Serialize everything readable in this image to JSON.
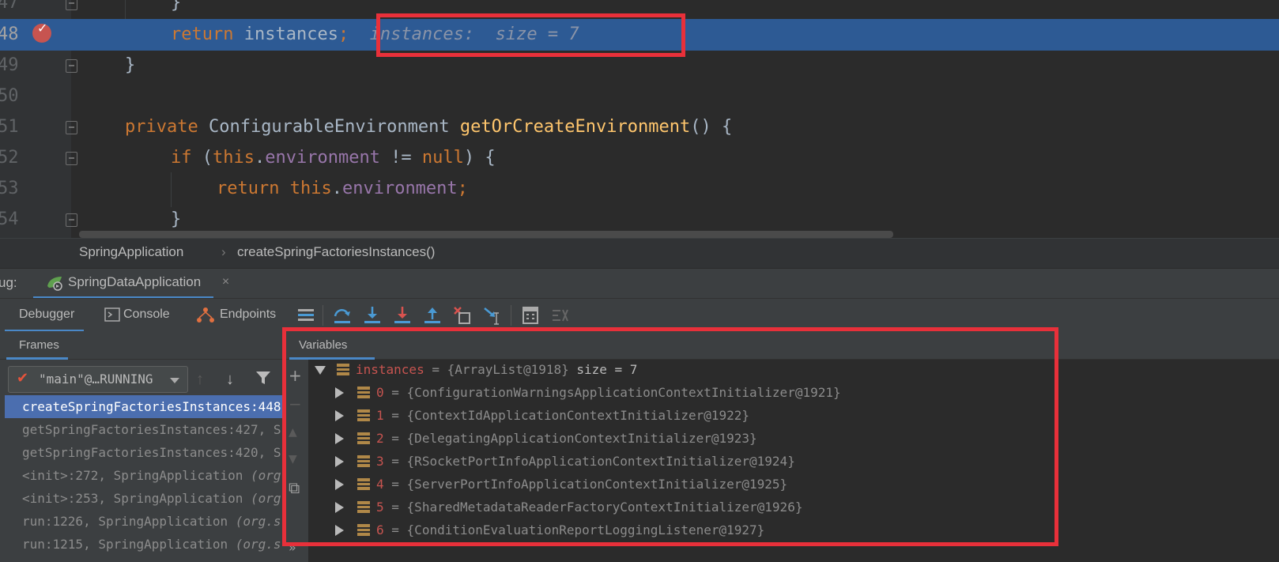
{
  "editor": {
    "lines": [
      {
        "num": "47",
        "code": [
          {
            "t": "}",
            "c": "plain"
          }
        ]
      },
      {
        "num": "48",
        "code": [
          {
            "t": "return",
            "c": "kw"
          },
          {
            "t": " instances",
            "c": "plain"
          },
          {
            "t": ";",
            "c": "kw"
          }
        ],
        "hint": "instances:  size = 7"
      },
      {
        "num": "49",
        "code": [
          {
            "t": "}",
            "c": "plain"
          }
        ]
      },
      {
        "num": "50",
        "code": []
      },
      {
        "num": "51",
        "code": [
          {
            "t": "private",
            "c": "kw"
          },
          {
            "t": " ConfigurableEnvironment ",
            "c": "plain"
          },
          {
            "t": "getOrCreateEnvironment",
            "c": "fn"
          },
          {
            "t": "() {",
            "c": "plain"
          }
        ]
      },
      {
        "num": "52",
        "code": [
          {
            "t": "if",
            "c": "kw"
          },
          {
            "t": " (",
            "c": "plain"
          },
          {
            "t": "this",
            "c": "kw"
          },
          {
            "t": ".",
            "c": "plain"
          },
          {
            "t": "environment",
            "c": "fld"
          },
          {
            "t": " != ",
            "c": "plain"
          },
          {
            "t": "null",
            "c": "kw"
          },
          {
            "t": ") {",
            "c": "plain"
          }
        ]
      },
      {
        "num": "53",
        "code": [
          {
            "t": "return",
            "c": "kw"
          },
          {
            "t": " ",
            "c": "plain"
          },
          {
            "t": "this",
            "c": "kw"
          },
          {
            "t": ".",
            "c": "plain"
          },
          {
            "t": "environment",
            "c": "fld"
          },
          {
            "t": ";",
            "c": "kw"
          }
        ]
      },
      {
        "num": "54",
        "code": [
          {
            "t": "}",
            "c": "plain"
          }
        ]
      }
    ]
  },
  "breadcrumb": {
    "class_name": "SpringApplication",
    "separator": "›",
    "method": "createSpringFactoriesInstances()"
  },
  "debug": {
    "label": "ug:",
    "run_config": "SpringDataApplication",
    "close": "×"
  },
  "toolbar": {
    "tabs": [
      "Debugger",
      "Console",
      "Endpoints"
    ],
    "buttons": [
      "layout-icon",
      "step-over-icon",
      "step-into-icon",
      "force-step-into-icon",
      "step-out-icon",
      "drop-frame-icon",
      "run-to-cursor-icon",
      "evaluate-expression-icon",
      "trace-icon"
    ]
  },
  "frames": {
    "title": "Frames",
    "thread": "\"main\"@…RUNNING",
    "items": [
      {
        "text": "createSpringFactoriesInstances:448",
        "extra": ""
      },
      {
        "text": "getSpringFactoriesInstances:427, S",
        "extra": ""
      },
      {
        "text": "getSpringFactoriesInstances:420, S",
        "extra": ""
      },
      {
        "text": "<init>:272, SpringApplication ",
        "extra": "(org"
      },
      {
        "text": "<init>:253, SpringApplication ",
        "extra": "(org"
      },
      {
        "text": "run:1226, SpringApplication ",
        "extra": "(org.s"
      },
      {
        "text": "run:1215, SpringApplication ",
        "extra": "(org.s"
      }
    ]
  },
  "variables": {
    "title": "Variables",
    "root": {
      "name": "instances",
      "eq": " = ",
      "value": "{ArrayList@1918}",
      "size": "  size = 7"
    },
    "children": [
      {
        "name": "0",
        "value": "{ConfigurationWarningsApplicationContextInitializer@1921}"
      },
      {
        "name": "1",
        "value": "{ContextIdApplicationContextInitializer@1922}"
      },
      {
        "name": "2",
        "value": "{DelegatingApplicationContextInitializer@1923}"
      },
      {
        "name": "3",
        "value": "{RSocketPortInfoApplicationContextInitializer@1924}"
      },
      {
        "name": "4",
        "value": "{ServerPortInfoApplicationContextInitializer@1925}"
      },
      {
        "name": "5",
        "value": "{SharedMetadataReaderFactoryContextInitializer@1926}"
      },
      {
        "name": "6",
        "value": "{ConditionEvaluationReportLoggingListener@1927}"
      }
    ],
    "side_buttons": [
      "+",
      "−",
      "▲",
      "▼",
      "⧉",
      "»"
    ]
  },
  "colors": {
    "highlight_box": "#e8303a",
    "selection": "#2d5a94",
    "accent": "#4a88c7"
  }
}
